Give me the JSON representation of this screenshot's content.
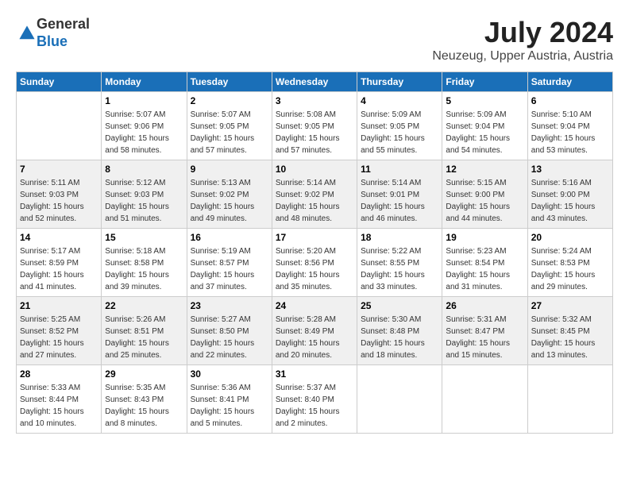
{
  "header": {
    "logo_line1": "General",
    "logo_line2": "Blue",
    "month": "July 2024",
    "location": "Neuzeug, Upper Austria, Austria"
  },
  "columns": [
    "Sunday",
    "Monday",
    "Tuesday",
    "Wednesday",
    "Thursday",
    "Friday",
    "Saturday"
  ],
  "weeks": [
    [
      {
        "day": "",
        "sunrise": "",
        "sunset": "",
        "daylight": ""
      },
      {
        "day": "1",
        "sunrise": "Sunrise: 5:07 AM",
        "sunset": "Sunset: 9:06 PM",
        "daylight": "Daylight: 15 hours and 58 minutes."
      },
      {
        "day": "2",
        "sunrise": "Sunrise: 5:07 AM",
        "sunset": "Sunset: 9:05 PM",
        "daylight": "Daylight: 15 hours and 57 minutes."
      },
      {
        "day": "3",
        "sunrise": "Sunrise: 5:08 AM",
        "sunset": "Sunset: 9:05 PM",
        "daylight": "Daylight: 15 hours and 57 minutes."
      },
      {
        "day": "4",
        "sunrise": "Sunrise: 5:09 AM",
        "sunset": "Sunset: 9:05 PM",
        "daylight": "Daylight: 15 hours and 55 minutes."
      },
      {
        "day": "5",
        "sunrise": "Sunrise: 5:09 AM",
        "sunset": "Sunset: 9:04 PM",
        "daylight": "Daylight: 15 hours and 54 minutes."
      },
      {
        "day": "6",
        "sunrise": "Sunrise: 5:10 AM",
        "sunset": "Sunset: 9:04 PM",
        "daylight": "Daylight: 15 hours and 53 minutes."
      }
    ],
    [
      {
        "day": "7",
        "sunrise": "Sunrise: 5:11 AM",
        "sunset": "Sunset: 9:03 PM",
        "daylight": "Daylight: 15 hours and 52 minutes."
      },
      {
        "day": "8",
        "sunrise": "Sunrise: 5:12 AM",
        "sunset": "Sunset: 9:03 PM",
        "daylight": "Daylight: 15 hours and 51 minutes."
      },
      {
        "day": "9",
        "sunrise": "Sunrise: 5:13 AM",
        "sunset": "Sunset: 9:02 PM",
        "daylight": "Daylight: 15 hours and 49 minutes."
      },
      {
        "day": "10",
        "sunrise": "Sunrise: 5:14 AM",
        "sunset": "Sunset: 9:02 PM",
        "daylight": "Daylight: 15 hours and 48 minutes."
      },
      {
        "day": "11",
        "sunrise": "Sunrise: 5:14 AM",
        "sunset": "Sunset: 9:01 PM",
        "daylight": "Daylight: 15 hours and 46 minutes."
      },
      {
        "day": "12",
        "sunrise": "Sunrise: 5:15 AM",
        "sunset": "Sunset: 9:00 PM",
        "daylight": "Daylight: 15 hours and 44 minutes."
      },
      {
        "day": "13",
        "sunrise": "Sunrise: 5:16 AM",
        "sunset": "Sunset: 9:00 PM",
        "daylight": "Daylight: 15 hours and 43 minutes."
      }
    ],
    [
      {
        "day": "14",
        "sunrise": "Sunrise: 5:17 AM",
        "sunset": "Sunset: 8:59 PM",
        "daylight": "Daylight: 15 hours and 41 minutes."
      },
      {
        "day": "15",
        "sunrise": "Sunrise: 5:18 AM",
        "sunset": "Sunset: 8:58 PM",
        "daylight": "Daylight: 15 hours and 39 minutes."
      },
      {
        "day": "16",
        "sunrise": "Sunrise: 5:19 AM",
        "sunset": "Sunset: 8:57 PM",
        "daylight": "Daylight: 15 hours and 37 minutes."
      },
      {
        "day": "17",
        "sunrise": "Sunrise: 5:20 AM",
        "sunset": "Sunset: 8:56 PM",
        "daylight": "Daylight: 15 hours and 35 minutes."
      },
      {
        "day": "18",
        "sunrise": "Sunrise: 5:22 AM",
        "sunset": "Sunset: 8:55 PM",
        "daylight": "Daylight: 15 hours and 33 minutes."
      },
      {
        "day": "19",
        "sunrise": "Sunrise: 5:23 AM",
        "sunset": "Sunset: 8:54 PM",
        "daylight": "Daylight: 15 hours and 31 minutes."
      },
      {
        "day": "20",
        "sunrise": "Sunrise: 5:24 AM",
        "sunset": "Sunset: 8:53 PM",
        "daylight": "Daylight: 15 hours and 29 minutes."
      }
    ],
    [
      {
        "day": "21",
        "sunrise": "Sunrise: 5:25 AM",
        "sunset": "Sunset: 8:52 PM",
        "daylight": "Daylight: 15 hours and 27 minutes."
      },
      {
        "day": "22",
        "sunrise": "Sunrise: 5:26 AM",
        "sunset": "Sunset: 8:51 PM",
        "daylight": "Daylight: 15 hours and 25 minutes."
      },
      {
        "day": "23",
        "sunrise": "Sunrise: 5:27 AM",
        "sunset": "Sunset: 8:50 PM",
        "daylight": "Daylight: 15 hours and 22 minutes."
      },
      {
        "day": "24",
        "sunrise": "Sunrise: 5:28 AM",
        "sunset": "Sunset: 8:49 PM",
        "daylight": "Daylight: 15 hours and 20 minutes."
      },
      {
        "day": "25",
        "sunrise": "Sunrise: 5:30 AM",
        "sunset": "Sunset: 8:48 PM",
        "daylight": "Daylight: 15 hours and 18 minutes."
      },
      {
        "day": "26",
        "sunrise": "Sunrise: 5:31 AM",
        "sunset": "Sunset: 8:47 PM",
        "daylight": "Daylight: 15 hours and 15 minutes."
      },
      {
        "day": "27",
        "sunrise": "Sunrise: 5:32 AM",
        "sunset": "Sunset: 8:45 PM",
        "daylight": "Daylight: 15 hours and 13 minutes."
      }
    ],
    [
      {
        "day": "28",
        "sunrise": "Sunrise: 5:33 AM",
        "sunset": "Sunset: 8:44 PM",
        "daylight": "Daylight: 15 hours and 10 minutes."
      },
      {
        "day": "29",
        "sunrise": "Sunrise: 5:35 AM",
        "sunset": "Sunset: 8:43 PM",
        "daylight": "Daylight: 15 hours and 8 minutes."
      },
      {
        "day": "30",
        "sunrise": "Sunrise: 5:36 AM",
        "sunset": "Sunset: 8:41 PM",
        "daylight": "Daylight: 15 hours and 5 minutes."
      },
      {
        "day": "31",
        "sunrise": "Sunrise: 5:37 AM",
        "sunset": "Sunset: 8:40 PM",
        "daylight": "Daylight: 15 hours and 2 minutes."
      },
      {
        "day": "",
        "sunrise": "",
        "sunset": "",
        "daylight": ""
      },
      {
        "day": "",
        "sunrise": "",
        "sunset": "",
        "daylight": ""
      },
      {
        "day": "",
        "sunrise": "",
        "sunset": "",
        "daylight": ""
      }
    ]
  ]
}
